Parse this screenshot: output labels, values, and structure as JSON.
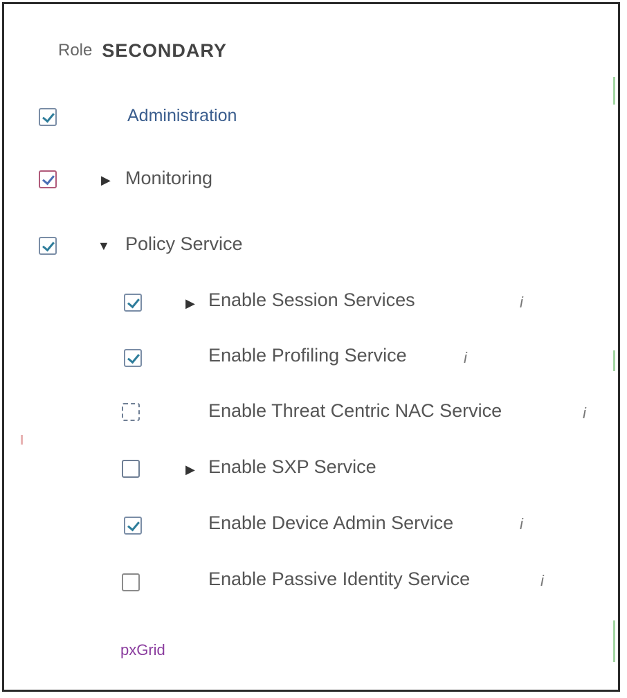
{
  "role": {
    "label": "Role",
    "value": "SECONDARY"
  },
  "services": [
    {
      "label": "Administration",
      "checked": true
    },
    {
      "label": "Monitoring",
      "checked": true,
      "expandable": true
    },
    {
      "label": "Policy Service",
      "checked": true,
      "expanded": true
    }
  ],
  "policy_options": [
    {
      "label": "Enable Session Services",
      "checked": true,
      "expandable": true,
      "info": "i"
    },
    {
      "label": "Enable Profiling Service",
      "checked": true,
      "info": "i"
    },
    {
      "label": "Enable Threat Centric NAC Service",
      "checked": false,
      "info": "i"
    },
    {
      "label": "Enable SXP Service",
      "checked": false,
      "expandable": true
    },
    {
      "label": "Enable Device Admin Service",
      "checked": true,
      "info": "i"
    },
    {
      "label": "Enable Passive Identity Service",
      "checked": false,
      "info": "i"
    }
  ],
  "footer": {
    "link": "pxGrid"
  },
  "colors": {
    "check": "#2e7d9b",
    "checkbox_border": "#7a8da6",
    "link": "#8a3c9e"
  }
}
